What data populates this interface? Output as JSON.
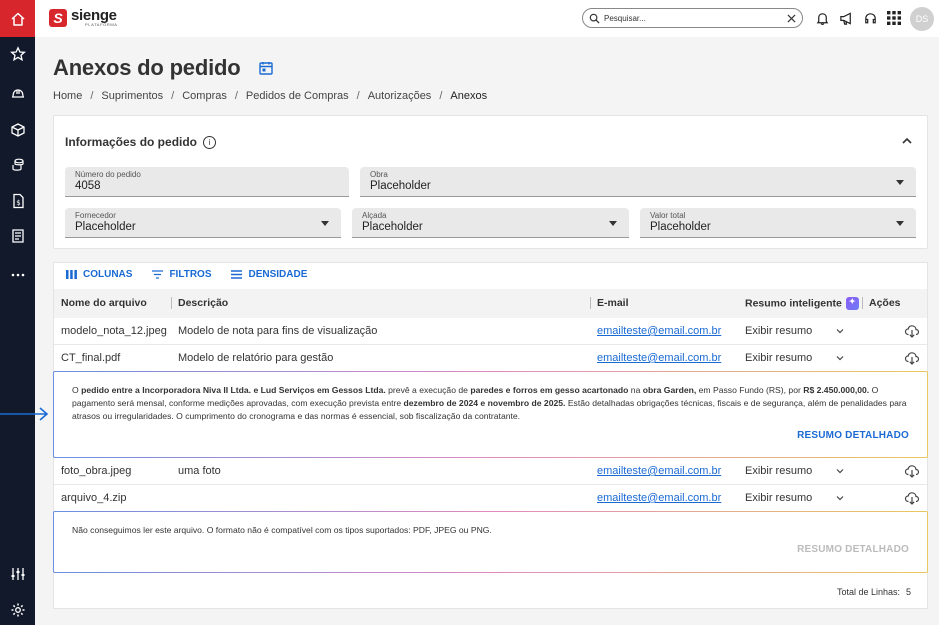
{
  "app": {
    "logo_text": "sienge",
    "logo_sub": "PLATAFORMA"
  },
  "search": {
    "placeholder": "Pesquisar..."
  },
  "user": {
    "initials": "DS"
  },
  "page": {
    "title": "Anexos do pedido"
  },
  "breadcrumb": [
    "Home",
    "Suprimentos",
    "Compras",
    "Pedidos de Compras",
    "Autorizações",
    "Anexos"
  ],
  "info": {
    "title": "Informações do pedido",
    "fields": {
      "numero": {
        "label": "Número do pedido",
        "value": "4058"
      },
      "obra": {
        "label": "Obra",
        "value": "Placeholder"
      },
      "fornecedor": {
        "label": "Fornecedor",
        "value": "Placeholder"
      },
      "alcada": {
        "label": "Alçada",
        "value": "Placeholder"
      },
      "valor": {
        "label": "Valor total",
        "value": "Placeholder"
      }
    }
  },
  "toolbar": {
    "colunas": "COLUNAS",
    "filtros": "FILTROS",
    "densidade": "DENSIDADE"
  },
  "table": {
    "headers": {
      "nome": "Nome do arquivo",
      "descricao": "Descrição",
      "email": "E-mail",
      "resumo": "Resumo inteligente",
      "acoes": "Ações"
    },
    "rows": [
      {
        "nome": "modelo_nota_12.jpeg",
        "descricao": "Modelo de nota para fins de visualização",
        "email": "emailteste@email.com.br",
        "resumo": "Exibir resumo"
      },
      {
        "nome": "CT_final.pdf",
        "descricao": "Modelo de relatório para gestão",
        "email": "emailteste@email.com.br",
        "resumo": "Exibir resumo"
      },
      {
        "nome": "foto_obra.jpeg",
        "descricao": "uma foto",
        "email": "emailteste@email.com.br",
        "resumo": "Exibir resumo"
      },
      {
        "nome": "arquivo_4.zip",
        "descricao": "",
        "email": "emailteste@email.com.br",
        "resumo": "Exibir resumo"
      }
    ]
  },
  "summary1": {
    "p1": "O ",
    "b1": "pedido entre a Incorporadora Niva II Ltda. e Lud Serviços em Gessos Ltda.",
    "p2": " prevê a execução de ",
    "b2": "paredes e forros em gesso acartonado",
    "p3": " na ",
    "b3": "obra Garden,",
    "p4": " em Passo Fundo (RS), por ",
    "b4": "R$ 2.450.000,00.",
    "p5": " O pagamento será mensal, conforme medições aprovadas, com execução prevista entre ",
    "b5": "dezembro de 2024 e novembro de 2025.",
    "p6": " Estão detalhadas obrigações técnicas, fiscais e de segurança, além de penalidades para atrasos ou irregularidades. O cumprimento do cronograma e das normas é essencial, sob fiscalização da contratante.",
    "button": "RESUMO DETALHADO"
  },
  "summary2": {
    "text": "Não conseguimos ler este arquivo. O formato não é compatível com os tipos suportados: PDF, JPEG ou PNG.",
    "button": "RESUMO DETALHADO"
  },
  "footer": {
    "label": "Total de Linhas:",
    "count": "5"
  },
  "colors": {
    "brand": "#d8262d",
    "rail": "#12192b",
    "link": "#1a6ad4"
  }
}
